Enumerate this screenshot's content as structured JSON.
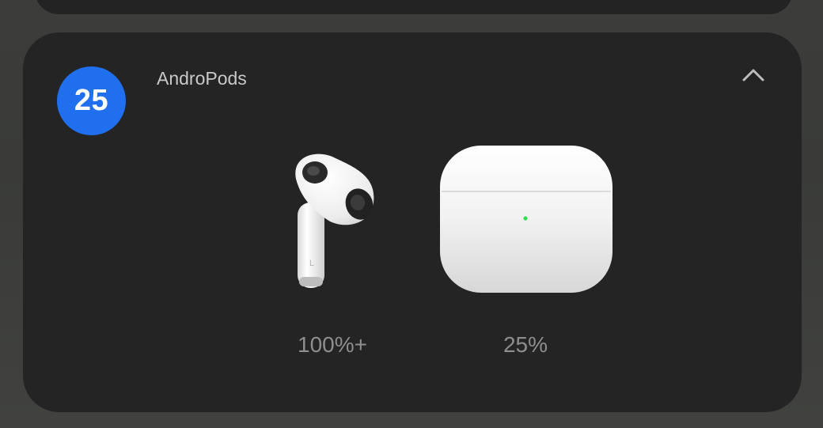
{
  "widget": {
    "app_icon_text": "25",
    "title": "AndroPods",
    "collapse_icon": "chevron-up-icon"
  },
  "devices": {
    "left_earbud": {
      "side_label": "L",
      "battery": "100%+"
    },
    "case": {
      "battery": "25%",
      "status_light": "#33dd55"
    }
  },
  "colors": {
    "badge": "#1f6fee",
    "card": "#242424",
    "battery_text": "#8e8e8e"
  }
}
